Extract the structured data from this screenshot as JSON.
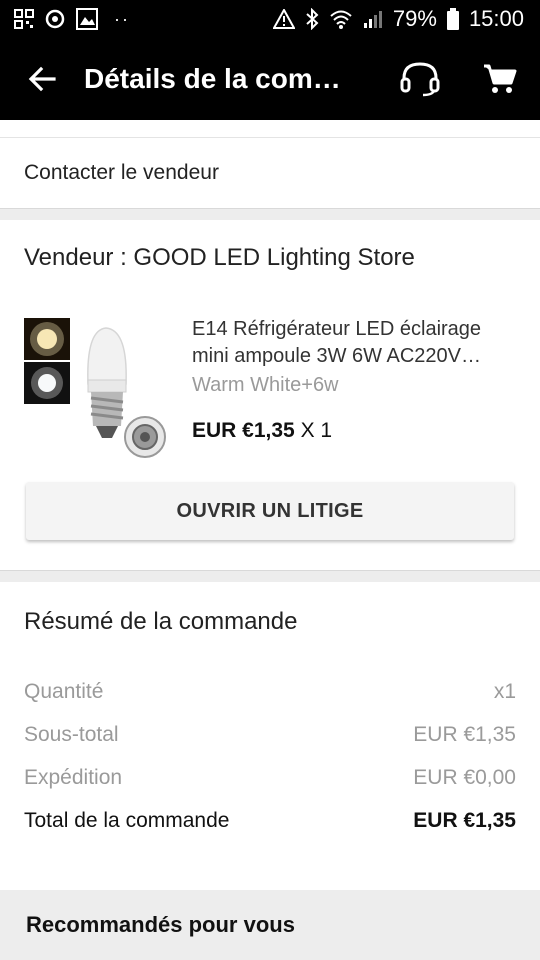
{
  "status_bar": {
    "battery": "79%",
    "time": "15:00",
    "dots": "··"
  },
  "header": {
    "title": "Détails de la com…"
  },
  "contact": {
    "label": "Contacter le vendeur"
  },
  "seller": {
    "title": "Vendeur : GOOD LED Lighting Store"
  },
  "product": {
    "name": "E14 Réfrigérateur LED éclairage mini ampoule 3W 6W AC220V…",
    "variant": "Warm White+6w",
    "price": "EUR €1,35",
    "quantity": "X 1"
  },
  "dispute": {
    "label": "OUVRIR UN LITIGE"
  },
  "summary": {
    "title": "Résumé de la commande",
    "rows": [
      {
        "label": "Quantité",
        "value": "x1"
      },
      {
        "label": "Sous-total",
        "value": "EUR €1,35"
      },
      {
        "label": "Expédition",
        "value": "EUR €0,00"
      },
      {
        "label": "Total de la commande",
        "value": "EUR €1,35"
      }
    ]
  },
  "recommended": {
    "title": "Recommandés pour vous"
  },
  "colors": {
    "header_bg": "#000000",
    "separator": "#ededed",
    "muted_text": "#9a9a9a",
    "button_bg": "#f4f4f4"
  }
}
